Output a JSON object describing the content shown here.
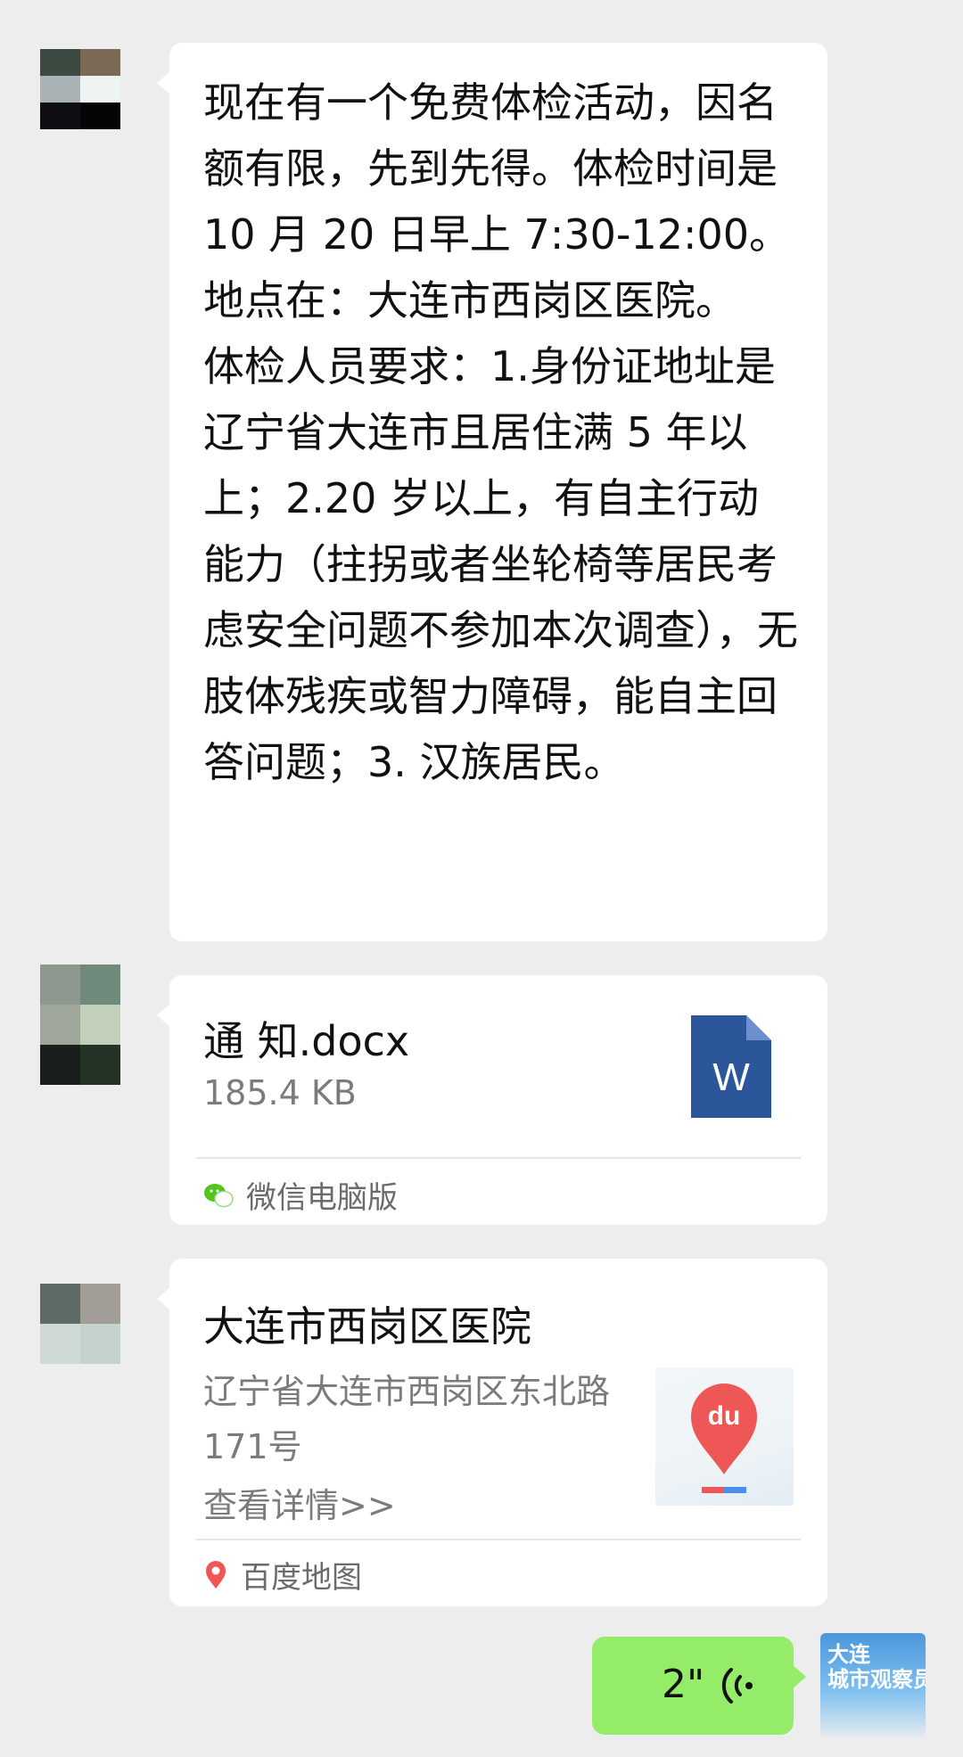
{
  "messages": {
    "text_message": {
      "text": "现在有一个免费体检活动，因名额有限，先到先得。体检时间是 10 月 20 日早上 7:30-12:00。地点在：大连市西岗区医院。\n体检人员要求：1.身份证地址是辽宁省大连市且居住满 5 年以上；2.20 岁以上，有自主行动能力（拄拐或者坐轮椅等居民考虑安全问题不参加本次调查），无肢体残疾或智力障碍，能自主回答问题；3. 汉族居民。"
    },
    "file_message": {
      "name": "通 知.docx",
      "size": "185.4 KB",
      "icon": "word-doc-icon",
      "icon_letter": "W",
      "source": "微信电脑版",
      "source_icon": "wechat-icon"
    },
    "location_message": {
      "title": "大连市西岗区医院",
      "address": "辽宁省大连市西岗区东北路171号",
      "detail_link": "查看详情>>",
      "map_logo": "du",
      "source": "百度地图",
      "source_icon": "baidu-map-icon"
    },
    "voice_message": {
      "duration": "2\"",
      "icon": "voice-wave-icon"
    }
  },
  "self_avatar": {
    "text": "大连\n城市观察员"
  },
  "colors": {
    "background": "#ededed",
    "bubble_incoming": "#ffffff",
    "bubble_outgoing": "#95ec69",
    "word_blue": "#2b579a",
    "baidu_red": "#ef5656"
  }
}
